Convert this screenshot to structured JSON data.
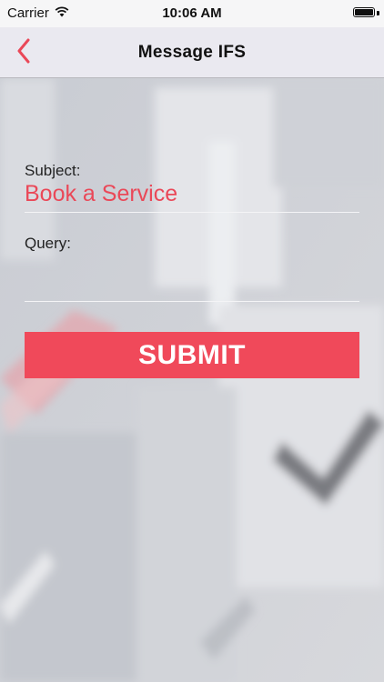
{
  "status_bar": {
    "carrier": "Carrier",
    "time": "10:06 AM",
    "icons": [
      "wifi-icon",
      "battery-icon"
    ]
  },
  "nav": {
    "title": "Message IFS",
    "back_icon": "chevron-left-icon"
  },
  "form": {
    "subject_label": "Subject:",
    "subject_value": "Book a Service",
    "query_label": "Query:",
    "query_value": "",
    "submit_label": "SUBMIT"
  },
  "colors": {
    "accent": "#ea4858",
    "button": "#f0495a",
    "nav_background": "#eae9f0"
  }
}
